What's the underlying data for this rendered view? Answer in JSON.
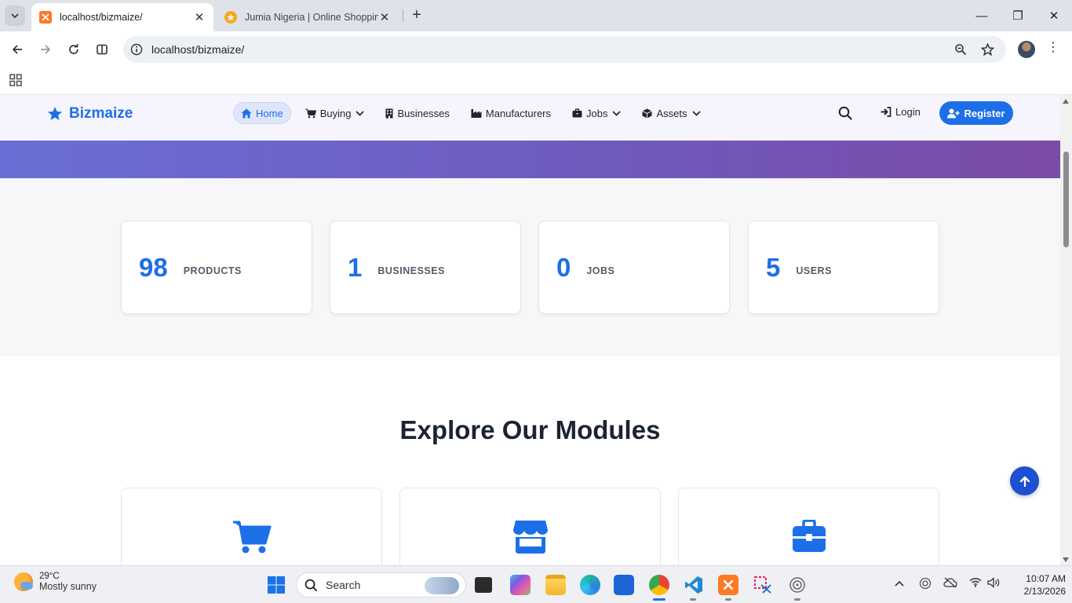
{
  "browser": {
    "tabs": [
      {
        "title": "localhost/bizmaize/",
        "active": true
      },
      {
        "title": "Jumia Nigeria | Online Shopping",
        "active": false
      }
    ],
    "url": "localhost/bizmaize/",
    "controls": {
      "minimize": "—",
      "restore": "❐",
      "close": "✕"
    }
  },
  "site": {
    "brand": "Bizmaize",
    "nav": {
      "home": "Home",
      "buying": "Buying",
      "businesses": "Businesses",
      "manufacturers": "Manufacturers",
      "jobs": "Jobs",
      "assets": "Assets"
    },
    "login": "Login",
    "register": "Register",
    "stats": [
      {
        "value": "98",
        "label": "PRODUCTS"
      },
      {
        "value": "1",
        "label": "BUSINESSES"
      },
      {
        "value": "0",
        "label": "JOBS"
      },
      {
        "value": "5",
        "label": "USERS"
      }
    ],
    "modules_title": "Explore Our Modules",
    "colors": {
      "primary": "#1d6fe8",
      "hero_start": "#6a6fd6",
      "hero_end": "#7b4ba6"
    }
  },
  "taskbar": {
    "weather_temp": "29°C",
    "weather_desc": "Mostly sunny",
    "search_placeholder": "Search",
    "time": "10:07 AM",
    "date": "2/13/2026"
  }
}
